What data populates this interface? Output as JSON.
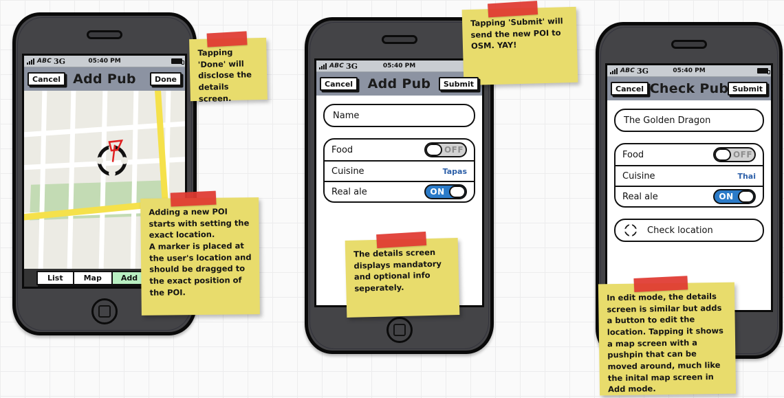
{
  "background": {
    "grid_color": "#ececed",
    "page_color": "#fafafa"
  },
  "accents": {
    "toggle_on": "#2b7bc8",
    "toggle_off": "#d2d2d2",
    "link": "#2c5fa8",
    "note": "#e8dc6c",
    "tape": "#e03a31",
    "navbar": "#8c93a2"
  },
  "phones": [
    {
      "id": "phone-add-map",
      "status": {
        "signal": "signal-bars-icon",
        "carrier": "ABC",
        "network": "3G",
        "time": "05:40 PM",
        "battery": "battery-icon"
      },
      "nav": {
        "left_button": "Cancel",
        "title": "Add Pub",
        "right_button": "Done"
      },
      "map": {
        "marker": "pushpin-marker-icon"
      },
      "tabs": [
        {
          "label": "List",
          "selected": false
        },
        {
          "label": "Map",
          "selected": false
        },
        {
          "label": "Add",
          "selected": true
        }
      ]
    },
    {
      "id": "phone-add-details",
      "status": {
        "signal": "signal-bars-icon",
        "carrier": "ABC",
        "network": "3G",
        "time": "05:40 PM",
        "battery": "battery-icon"
      },
      "nav": {
        "left_button": "Cancel",
        "title": "Add Pub",
        "right_button": "Submit"
      },
      "name_field": {
        "value": "",
        "placeholder": "Name"
      },
      "rows": [
        {
          "label": "Food",
          "type": "toggle",
          "state": "OFF"
        },
        {
          "label": "Cuisine",
          "type": "value",
          "value": "Tapas"
        },
        {
          "label": "Real ale",
          "type": "toggle",
          "state": "ON"
        }
      ]
    },
    {
      "id": "phone-check-pub",
      "status": {
        "signal": "signal-bars-icon",
        "carrier": "ABC",
        "network": "3G",
        "time": "05:40 PM",
        "battery": "battery-icon"
      },
      "nav": {
        "left_button": "Cancel",
        "title": "Check Pub",
        "right_button": "Submit"
      },
      "name_field": {
        "value": "The Golden Dragon",
        "placeholder": "Name"
      },
      "rows": [
        {
          "label": "Food",
          "type": "toggle",
          "state": "OFF"
        },
        {
          "label": "Cuisine",
          "type": "value",
          "value": "Thai"
        },
        {
          "label": "Real ale",
          "type": "toggle",
          "state": "ON"
        }
      ],
      "location_button": {
        "label": "Check location",
        "icon": "crosshair-icon"
      }
    }
  ],
  "notes": [
    {
      "id": "note-done",
      "text": "Tapping 'Done' will disclose the details screen."
    },
    {
      "id": "note-marker",
      "text": "Adding a new POI starts with setting the exact location.\nA marker is placed at the user's location and should be dragged to the exact position of the POI."
    },
    {
      "id": "note-submit",
      "text": "Tapping 'Submit' will send the new POI to OSM. YAY!"
    },
    {
      "id": "note-details",
      "text": "The details screen displays mandatory and optional info seperately."
    },
    {
      "id": "note-edit",
      "text": "In edit mode, the details screen is similar but adds a button to edit the location. Tapping it shows a map screen with a pushpin that can be moved around, much like the inital map screen in Add mode."
    }
  ]
}
